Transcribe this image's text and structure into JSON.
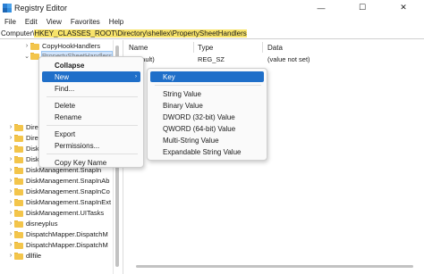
{
  "window": {
    "title": "Registry Editor",
    "controls": {
      "minimize": "—",
      "maximize": "☐",
      "close": "✕"
    }
  },
  "menubar": [
    "File",
    "Edit",
    "View",
    "Favorites",
    "Help"
  ],
  "address": {
    "prefix": "Computer\\",
    "highlighted": "HKEY_CLASSES_ROOT\\Directory\\shellex\\PropertySheetHandlers"
  },
  "tree": {
    "items": [
      {
        "label": "CopyHookHandlers",
        "chevron": "›"
      },
      {
        "label": "PropertySheetHandlers",
        "chevron": "⌄"
      },
      {
        "label": "",
        "chevron": ""
      },
      {
        "label": "",
        "chevron": ""
      },
      {
        "label": "",
        "chevron": ""
      },
      {
        "label": "",
        "chevron": ""
      },
      {
        "label": "",
        "chevron": ""
      },
      {
        "label": "",
        "chevron": ""
      },
      {
        "label": "Direct",
        "chevron": "›"
      },
      {
        "label": "Direct",
        "chevron": "›"
      },
      {
        "label": "DiskM",
        "chevron": "›"
      },
      {
        "label": "DiskManagement",
        "chevron": "›"
      },
      {
        "label": "DiskManagement.SnapIn",
        "chevron": "›"
      },
      {
        "label": "DiskManagement.SnapInAb",
        "chevron": "›"
      },
      {
        "label": "DiskManagement.SnapInCo",
        "chevron": "›"
      },
      {
        "label": "DiskManagement.SnapInExt",
        "chevron": "›"
      },
      {
        "label": "DiskManagement.UITasks",
        "chevron": "›"
      },
      {
        "label": "disneyplus",
        "chevron": "›"
      },
      {
        "label": "DispatchMapper.DispatchM",
        "chevron": "›"
      },
      {
        "label": "DispatchMapper.DispatchM",
        "chevron": "›"
      },
      {
        "label": "dllfile",
        "chevron": "›"
      }
    ]
  },
  "list": {
    "columns": [
      "Name",
      "Type",
      "Data"
    ],
    "rows": [
      {
        "name": "(Default)",
        "type": "REG_SZ",
        "data": "(value not set)"
      }
    ]
  },
  "context_menu": {
    "items": [
      "Collapse",
      "New",
      "Find...",
      "Delete",
      "Rename",
      "Export",
      "Permissions...",
      "Copy Key Name"
    ],
    "submenu_arrow": "›"
  },
  "new_submenu": {
    "items": [
      "Key",
      "String Value",
      "Binary Value",
      "DWORD (32-bit) Value",
      "QWORD (64-bit) Value",
      "Multi-String Value",
      "Expandable String Value"
    ]
  },
  "colors": {
    "accent": "#1f6fc9",
    "address_highlight": "#f7e36a",
    "folder": "#f3c54b",
    "selection": "#cfe3fb"
  }
}
